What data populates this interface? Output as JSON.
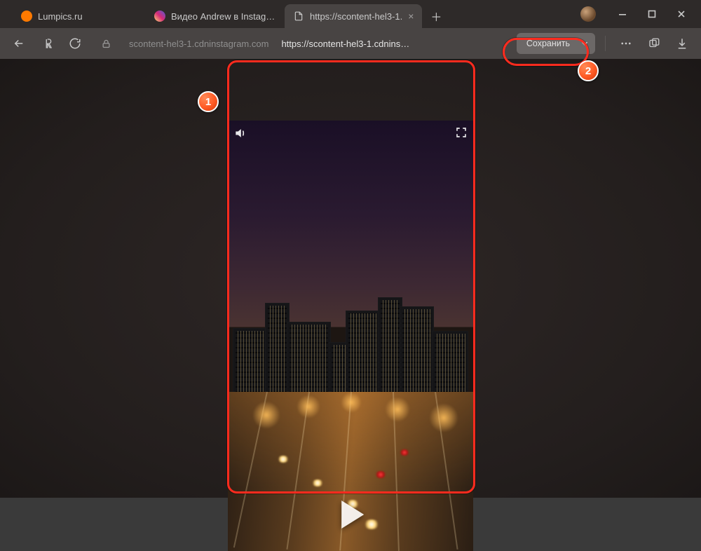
{
  "tabs": [
    {
      "label": "Lumpics.ru",
      "favicon_color": "#ff7a00"
    },
    {
      "label": "Видео Andrew в Instagram",
      "favicon_color": "#e1306c"
    },
    {
      "label": "https://scontent-hel3-1.",
      "favicon_color": "#bdbdbd",
      "active": true
    }
  ],
  "address": {
    "host": "scontent-hel3-1.cdninstagram.com",
    "display": "https://scontent-hel3-1.cdnins…"
  },
  "save_button": {
    "label": "Сохранить"
  },
  "annotations": {
    "marker1": "1",
    "marker2": "2"
  }
}
